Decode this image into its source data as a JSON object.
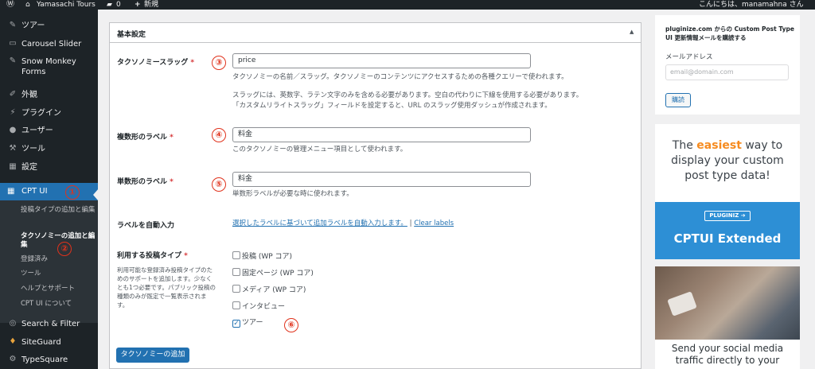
{
  "admin_bar": {
    "site_name": "Yamasachi Tours",
    "comments_count": "0",
    "new_label": "新規",
    "greeting": "こんにちは、manamahna さん"
  },
  "sidebar": {
    "items": [
      {
        "label": "ツアー",
        "icon": "pin-icon"
      },
      {
        "label": "Carousel Slider",
        "icon": "carousel-icon"
      },
      {
        "label": "Snow Monkey Forms",
        "icon": "pin-icon"
      },
      {
        "label": "外観",
        "icon": "brush-icon"
      },
      {
        "label": "プラグイン",
        "icon": "plugin-icon"
      },
      {
        "label": "ユーザー",
        "icon": "user-icon"
      },
      {
        "label": "ツール",
        "icon": "wrench-icon"
      },
      {
        "label": "設定",
        "icon": "settings-icon"
      },
      {
        "label": "CPT UI",
        "icon": "cptui-icon"
      },
      {
        "label": "Search & Filter",
        "icon": "search-filter-icon"
      },
      {
        "label": "SiteGuard",
        "icon": "siteguard-icon"
      },
      {
        "label": "TypeSquare",
        "icon": "gear-icon"
      }
    ],
    "cpt_submenu": [
      {
        "label": "投稿タイプの追加と編集"
      },
      {
        "label": "タクソノミーの追加と編集"
      },
      {
        "label": "登録済み"
      },
      {
        "label": "ツール"
      },
      {
        "label": "ヘルプとサポート"
      },
      {
        "label": "CPT UI について"
      }
    ]
  },
  "annotations": [
    "①",
    "②",
    "③",
    "④",
    "⑤",
    "⑥"
  ],
  "main": {
    "panel_title": "基本設定",
    "slug": {
      "label": "タクソノミースラッグ",
      "required": "*",
      "value": "price",
      "desc1": "タクソノミーの名前／スラッグ。タクソノミーのコンテンツにアクセスするための各種クエリーで使われます。",
      "desc2": "スラッグには、英数字、ラテン文字のみを含める必要があります。空白の代わりに下線を使用する必要があります。",
      "desc3": "「カスタムリライトスラッグ」フィールドを設定すると、URL のスラッグ使用ダッシュが作成されます。"
    },
    "plural": {
      "label": "複数形のラベル",
      "required": "*",
      "value": "料金",
      "desc": "このタクソノミーの管理メニュー項目として使われます。"
    },
    "singular": {
      "label": "単数形のラベル",
      "required": "*",
      "value": "料金",
      "desc": "単数形ラベルが必要な時に使われます。"
    },
    "autofill": {
      "label": "ラベルを自動入力",
      "link1": "選択したラベルに基づいて追加ラベルを自動入力します。",
      "sep": "|",
      "link2": "Clear labels"
    },
    "post_types": {
      "label": "利用する投稿タイプ",
      "required": "*",
      "help": [
        "利用可能な登録済み投稿タイプのた",
        "めのサポートを追加します。少なく",
        "とも1つ必要です。パブリック投稿の",
        "種類のみが既定で一覧表示されま",
        "す。"
      ],
      "options": [
        {
          "label": "投稿 (WP コア)",
          "checked": false
        },
        {
          "label": "固定ページ (WP コア)",
          "checked": false
        },
        {
          "label": "メディア (WP コア)",
          "checked": false
        },
        {
          "label": "インタビュー",
          "checked": false
        },
        {
          "label": "ツアー",
          "checked": true
        }
      ]
    },
    "submit_label": "タクソノミーの追加"
  },
  "side": {
    "subscribe_title_1": "pluginize.com からの Custom Post Type",
    "subscribe_title_2": "UI 更新情報メールを購読する",
    "email_label": "メールアドレス",
    "email_placeholder": "email@domain.com",
    "subscribe_button": "購読",
    "ad1_line1_pre": "The ",
    "ad1_line1_em": "easiest",
    "ad1_line1_post": " way to",
    "ad1_line2": "display your custom",
    "ad1_line3": "post type data!",
    "ad1_logo": "PLUGINIZ",
    "ad1_product": "CPTUI Extended",
    "ad2_line1": "Send your social media",
    "ad2_line2": "traffic directly to your",
    "colors": {
      "admin_bar": "#1d2327",
      "accent": "#2271b1",
      "easiest": "#f68b1f",
      "ad_blue": "#2d8fd5",
      "annotation": "#e0321c"
    }
  }
}
